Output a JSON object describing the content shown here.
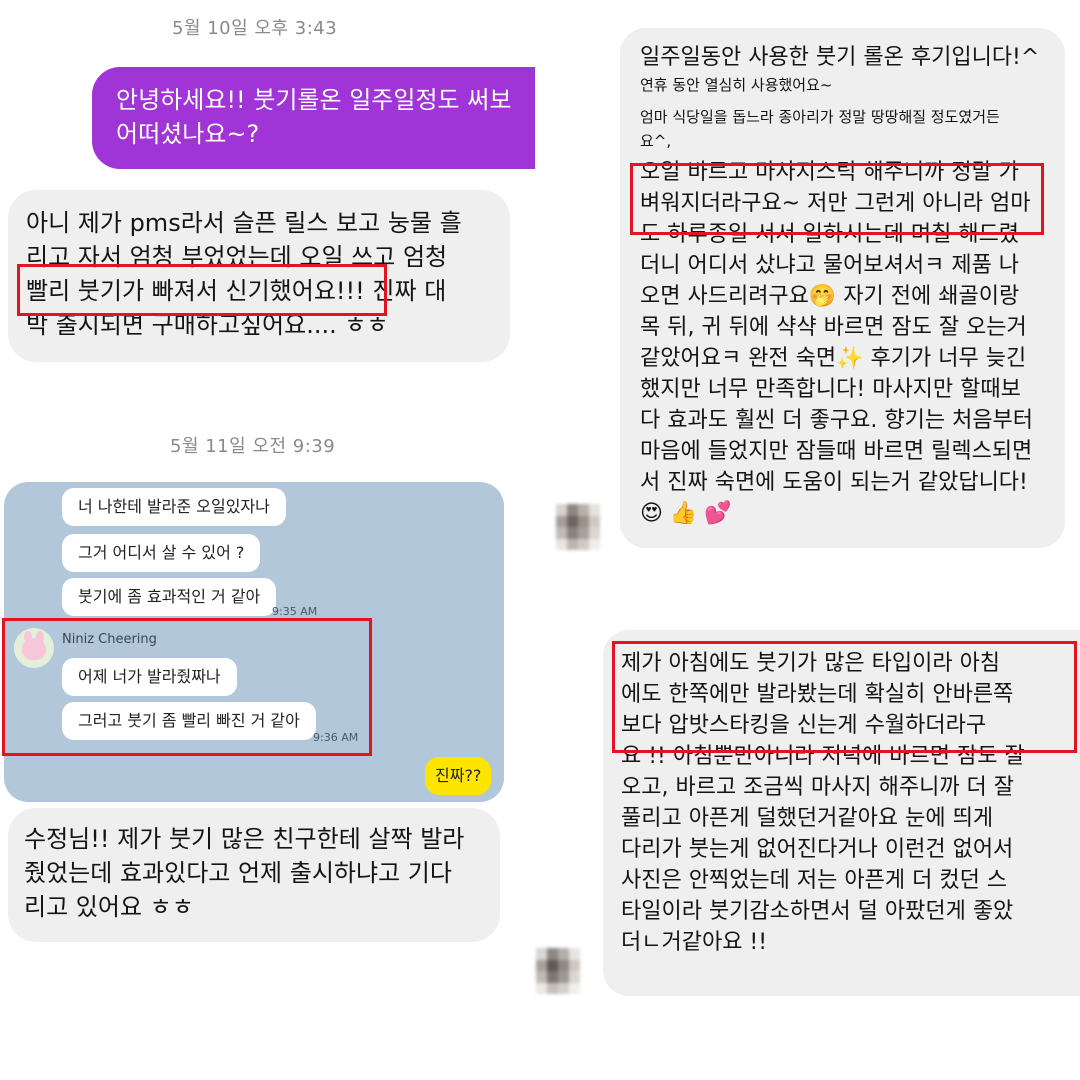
{
  "left": {
    "timestamp1": "5월 10일 오후 3:43",
    "purple_bubble": [
      "안녕하세요!! 붓기롤온 일주일정도 써보",
      "어떠셨나요~?"
    ],
    "reply1": [
      "아니 제가 pms라서 슬픈 릴스 보고 눙물 흘",
      "리고 자서 엄청 부었었는데 오일 쓰고 엄청",
      "빨리 붓기가 빠져서 신기했어요!!! 진짜 대",
      "박 출시되면 구매하고싶어요.... ㅎㅎ"
    ],
    "timestamp2": "5월 11일 오전 9:39",
    "kakao": {
      "msg1": "너 나한테 발라준 오일있자나",
      "msg2": "그거 어디서 살 수 있어 ?",
      "msg3": "붓기에 좀 효과적인 거 같아",
      "time1": "9:35 AM",
      "sender": "Niniz Cheering",
      "msg4": "어제 너가 발라줬짜나",
      "msg5": "그러고 붓기 좀 빨리 빠진 거 같아",
      "time2": "9:36 AM",
      "yellow": "진짜??"
    },
    "reply2": [
      "수정님!! 제가 붓기 많은 친구한테 살짝 발라",
      "줬었는데 효과있다고 언제 출시하냐고 기다",
      "리고 있어요 ㅎㅎ"
    ]
  },
  "right": {
    "review1_title": "일주일동안 사용한 붓기 롤온 후기입니다!^",
    "review1_small": [
      "연휴 동안 열심히 사용했어요~",
      "엄마 식당일을 돕느라 종아리가 정말 땅땅해질 정도였거든",
      "요^,"
    ],
    "review1_body": [
      "오일 바르고 마사지스틱 해주니까 정말 가",
      "벼워지더라구요~ 저만 그런게 아니라 엄마",
      "도 하루종일 서서 일하시는데 며칠 해드렸",
      "더니 어디서 샀냐고 물어보셔서ㅋ 제품 나",
      "오면 사드리려구요🤭 자기 전에 쇄골이랑",
      "목 뒤, 귀 뒤에 샥샥 바르면 잠도 잘 오는거",
      "같았어요ㅋ 완전 숙면✨ 후기가 너무 늦긴",
      "했지만 너무 만족합니다! 마사지만 할때보",
      "다 효과도 훨씬 더 좋구요. 향기는 처음부터",
      "마음에 들었지만 잠들때 바르면 릴렉스되면",
      "서 진짜 숙면에 도움이 되는거 같았답니다!",
      "😍 👍 💕"
    ],
    "review2_body": [
      "제가 아침에도 붓기가 많은 타입이라 아침",
      "에도 한쪽에만 발라봤는데 확실히 안바른쪽",
      "보다 압밧스타킹을 신는게 수월하더라구",
      "요 !! 아침뿐만아니라 저녁에 바르면 잠도 잘",
      "오고, 바르고 조금씩 마사지 해주니까 더 잘",
      "풀리고 아픈게 덜했던거같아요 눈에 띄게",
      "다리가 붓는게 없어진다거나 이런건 없어서",
      "사진은 안찍었는데 저는 아픈게 더 컸던 스",
      "타일이라 붓기감소하면서 덜 아팠던게 좋았",
      "더ㄴ거같아요 !!"
    ]
  },
  "colors": {
    "purple": "#a034d6",
    "highlight_red": "#e2141e",
    "kakao_bg": "#b2c7d9",
    "kakao_yellow": "#fee500",
    "bubble_gray": "#efefef"
  }
}
